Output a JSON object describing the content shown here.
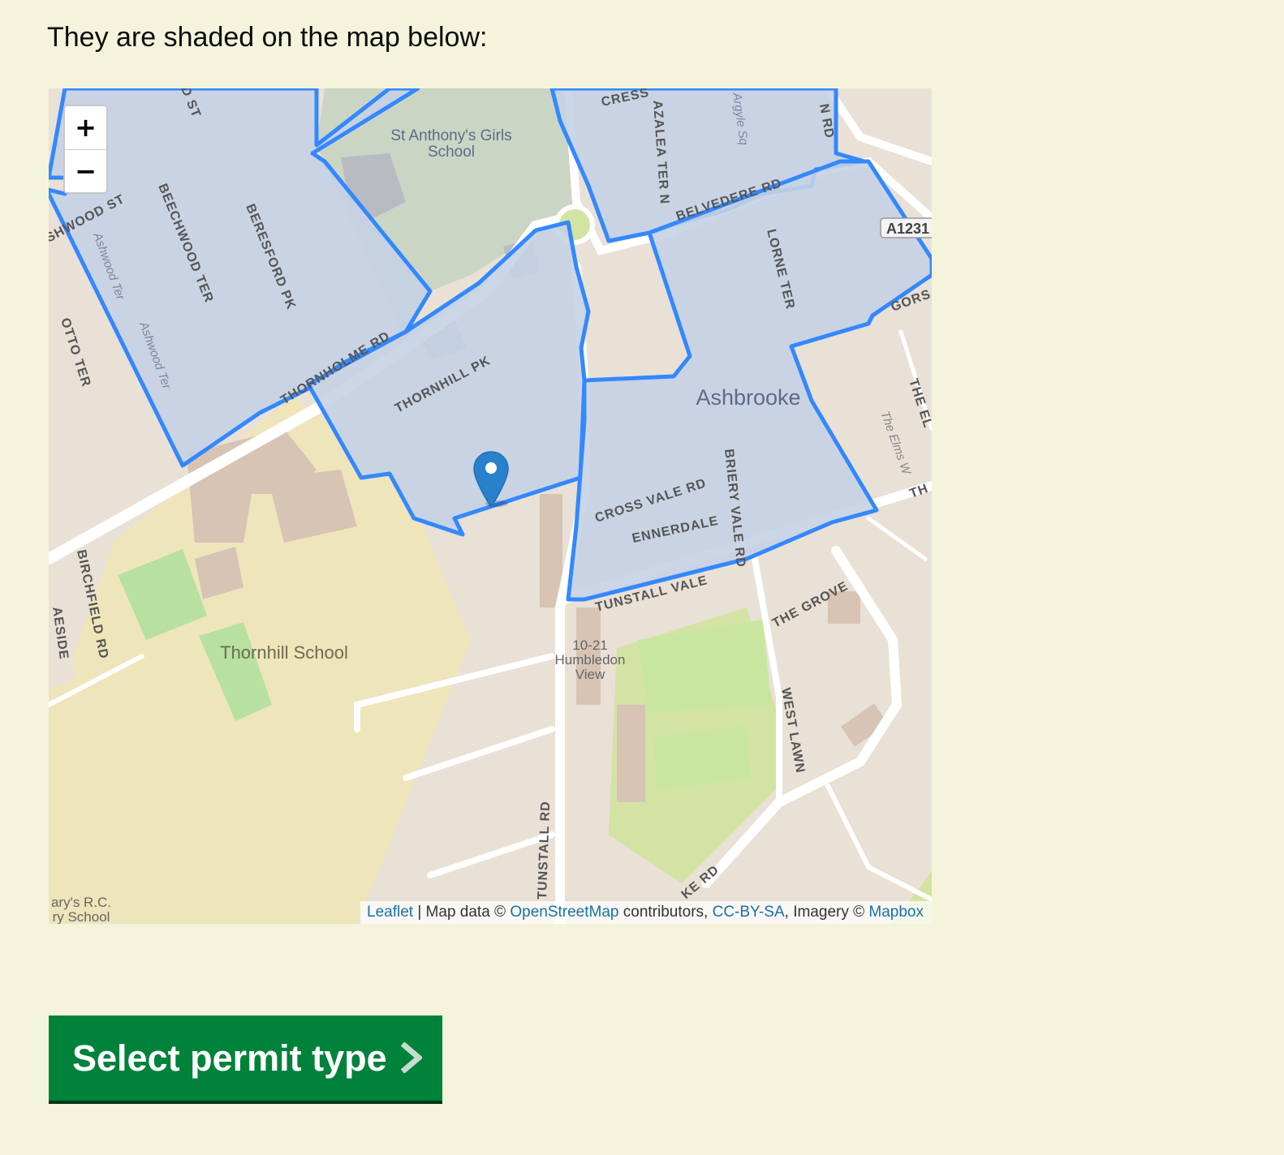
{
  "intro": {
    "text": "They are shaded on the map below:"
  },
  "map": {
    "zoom_in_label": "+",
    "zoom_out_label": "−",
    "labels": {
      "st_anthonys_1": "St Anthony's Girls",
      "st_anthonys_2": "School",
      "ashbrooke": "Ashbrooke",
      "thornhill_school": "Thornhill School",
      "humbledon_1": "10-21",
      "humbledon_2": "Humbledon",
      "humbledon_3": "View",
      "marys_1": "ary's R.C.",
      "marys_2": "ry School",
      "a1231": "A1231",
      "ashwood_st": "SHWOOD ST",
      "beechwood_ter": "BEECHWOOD TER",
      "beresford_pk": "BERESFORD PK",
      "ashwood_ter_1": "Ashwood Ter",
      "ashwood_ter_2": "Ashwood Ter",
      "otto_ter": "OTTO TER",
      "thornhill_pk": "THORNHILL PK",
      "thornholme_rd": "THORNHOLME RD",
      "cross_vale_rd": "CROSS VALE RD",
      "ennerdale": "ENNERDALE",
      "briery_vale_rd": "BRIERY VALE RD",
      "tunstall_vale": "TUNSTALL VALE",
      "the_grove": "THE GROVE",
      "west_lawn": "WEST LAWN",
      "tunstall_rd": "TUNSTALL RD",
      "birchfield_rd": "BIRCHFIELD RD",
      "aeside": "AESIDE",
      "lorne_ter": "LORNE TER",
      "azalea_ter": "AZALEA TER N",
      "argyle_sq": "Argyle Sq",
      "cress": "CRESS",
      "d_st": "D ST",
      "the_elms": "The Elms W",
      "the_el": "THE EL",
      "gors": "GORS",
      "ke_rd": "KE RD",
      "th": "TH",
      "n_rd": "N RD",
      "belvedere_rd": "BELVEDERE RD"
    },
    "colors": {
      "zone_fill": "#c5d2e4",
      "zone_stroke": "#3388ff",
      "background": "#e9e0d6",
      "school_fill": "#efe5bb",
      "park_fill": "#d3e3a3",
      "pitch_fill": "#c8e6a0",
      "building_fill": "#d7c4b5",
      "road_fill": "#ffffff",
      "marker": "#2a81cb"
    },
    "attribution": {
      "leaflet": "Leaflet",
      "sep": " | Map data © ",
      "osm": "OpenStreetMap",
      "contributors": " contributors, ",
      "license": "CC-BY-SA",
      "imagery": ", Imagery © ",
      "mapbox": "Mapbox"
    }
  },
  "cta": {
    "label": "Select permit type",
    "icon": "chevron-right-icon"
  }
}
